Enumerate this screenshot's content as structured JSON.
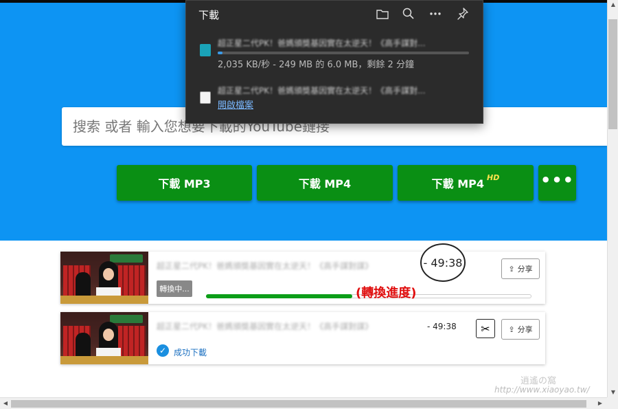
{
  "search": {
    "placeholder": "搜索 或者 輸入您想要下載的YouTube鏈接"
  },
  "buttons": {
    "mp3": "下載 MP3",
    "mp4": "下載 MP4",
    "mp4hd": "下載 MP4",
    "hd_badge": "HD",
    "more": "•••"
  },
  "results": [
    {
      "title": "超正星二代PK！爸媽頒獎基因實在太逆天！《高手謀對謀》",
      "duration": "- 49:38",
      "share_label": "分享",
      "status": "轉換中...",
      "progress_note": "(轉換進度)",
      "progress": 0.45
    },
    {
      "title": "超正星二代PK！爸媽頒獎基因實在太逆天！《高手謀對謀》",
      "duration": "- 49:38",
      "share_label": "分享",
      "status": "成功下載"
    }
  ],
  "download_panel": {
    "title": "下載",
    "items": [
      {
        "filename": "超正星二代PK！爸媽頒獎基因實在太逆天！《高手謀對...",
        "status": "2,035 KB/秒 - 249 MB 的 6.0 MB，剩餘 2 分鐘",
        "progress": 0.02
      },
      {
        "filename": "超正星二代PK！爸媽頒獎基因實在太逆天！《高手謀對...",
        "link": "開啟檔案"
      }
    ]
  },
  "watermark": {
    "url": "http://www.xiaoyao.tw/",
    "site_name": "逍遙の窩"
  },
  "icons": {
    "folder": "folder-icon",
    "search": "search-icon",
    "more": "more-icon",
    "pin": "pin-icon",
    "share": "share-icon",
    "scissors": "scissors-icon",
    "check": "check-icon"
  },
  "colors": {
    "hero": "#0d94f3",
    "button": "#0a8f14",
    "progress": "#0c9e18",
    "note": "#e00e0e",
    "panel": "#2b2b2b",
    "link": "#7ab8ff"
  }
}
